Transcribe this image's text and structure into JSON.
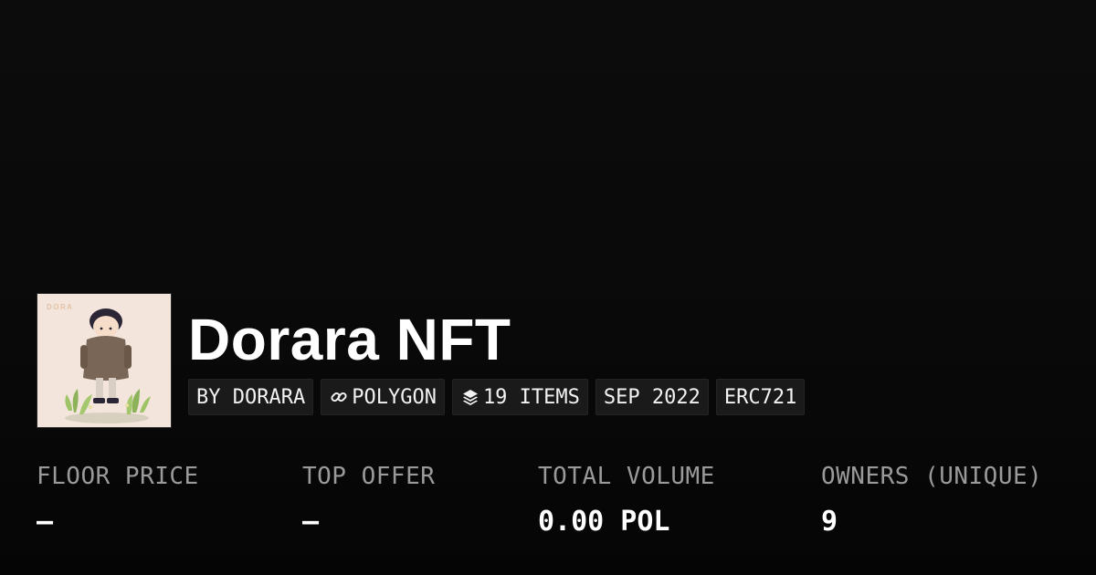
{
  "collection": {
    "name": "Dorara NFT",
    "avatar_text": "DORA"
  },
  "tags": {
    "creator": "BY DORARA",
    "chain": "POLYGON",
    "items": "19 ITEMS",
    "date": "SEP 2022",
    "standard": "ERC721"
  },
  "stats": {
    "floor_price": {
      "label": "FLOOR PRICE",
      "value": "–"
    },
    "top_offer": {
      "label": "TOP OFFER",
      "value": "–"
    },
    "total_volume": {
      "label": "TOTAL VOLUME",
      "value": "0.00 POL"
    },
    "owners": {
      "label": "OWNERS (UNIQUE)",
      "value": "9"
    }
  },
  "colors": {
    "background": "#0a0a0a",
    "tag_background": "#1a1a1a",
    "label_gray": "#9a9a9a",
    "avatar_background": "#f3e5dc"
  },
  "icons": {
    "chain": "link-icon",
    "items": "layers-icon"
  }
}
